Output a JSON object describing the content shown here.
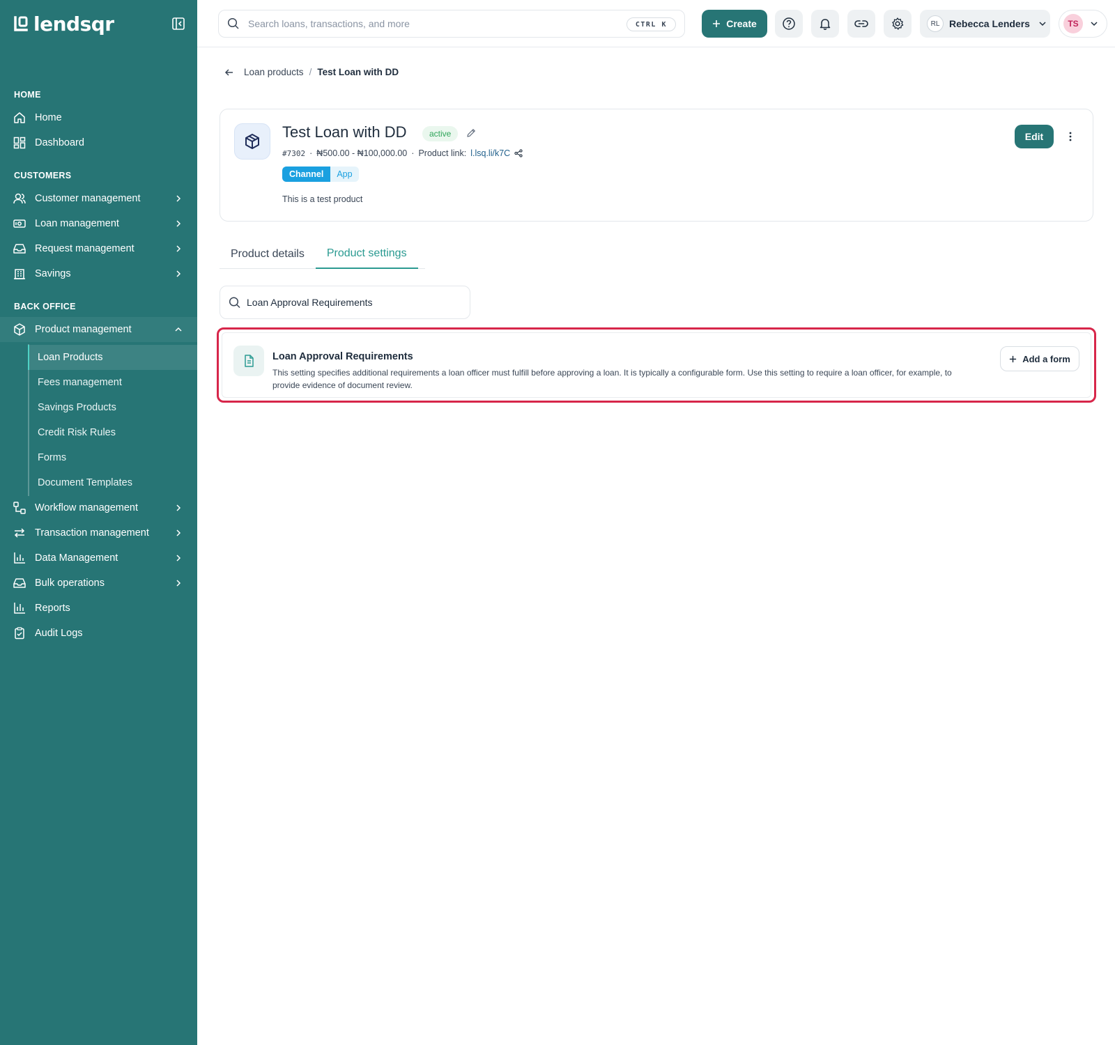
{
  "app": {
    "logo_text": "lendsqr"
  },
  "sidebar": {
    "sections": {
      "home": "HOME",
      "customers": "CUSTOMERS",
      "back_office": "BACK OFFICE"
    },
    "items": {
      "home": "Home",
      "dashboard": "Dashboard",
      "customer_management": "Customer management",
      "loan_management": "Loan management",
      "request_management": "Request management",
      "savings": "Savings",
      "product_management": "Product management",
      "workflow_management": "Workflow management",
      "transaction_management": "Transaction management",
      "data_management": "Data Management",
      "bulk_operations": "Bulk operations",
      "reports": "Reports",
      "audit_logs": "Audit Logs"
    },
    "product_submenu": [
      "Loan Products",
      "Fees management",
      "Savings Products",
      "Credit Risk Rules",
      "Forms",
      "Document Templates"
    ],
    "active_submenu": "Loan Products"
  },
  "topbar": {
    "search_placeholder": "Search loans, transactions, and more",
    "shortcut": "CTRL K",
    "create_label": "Create",
    "user_initials": "RL",
    "user_name": "Rebecca Lenders",
    "profile_initials": "TS"
  },
  "breadcrumb": {
    "parent": "Loan products",
    "separator": "/",
    "current": "Test Loan with DD"
  },
  "product": {
    "title": "Test Loan with DD",
    "status": "active",
    "code": "#7302",
    "dot": "·",
    "range": "₦500.00 - ₦100,000.00",
    "link_label": "Product link:",
    "link": "l.lsq.li/k7C",
    "channel_key": "Channel",
    "channel_value": "App",
    "description": "This is a test product",
    "edit_label": "Edit"
  },
  "tabs": [
    {
      "label": "Product details",
      "active": false
    },
    {
      "label": "Product settings",
      "active": true
    }
  ],
  "settings_search": {
    "value": "Loan Approval Requirements"
  },
  "setting": {
    "title": "Loan Approval Requirements",
    "description": "This setting specifies additional requirements a loan officer must fulfill before approving a loan. It is typically a configurable form. Use this setting to require a loan officer, for example, to provide evidence of document review.",
    "add_label": "Add a form"
  },
  "colors": {
    "brand": "#277575",
    "accent": "#2a9a91",
    "highlight_border": "#d7264a",
    "status_green": "#2fa55a",
    "channel_blue": "#1aa0e0"
  }
}
